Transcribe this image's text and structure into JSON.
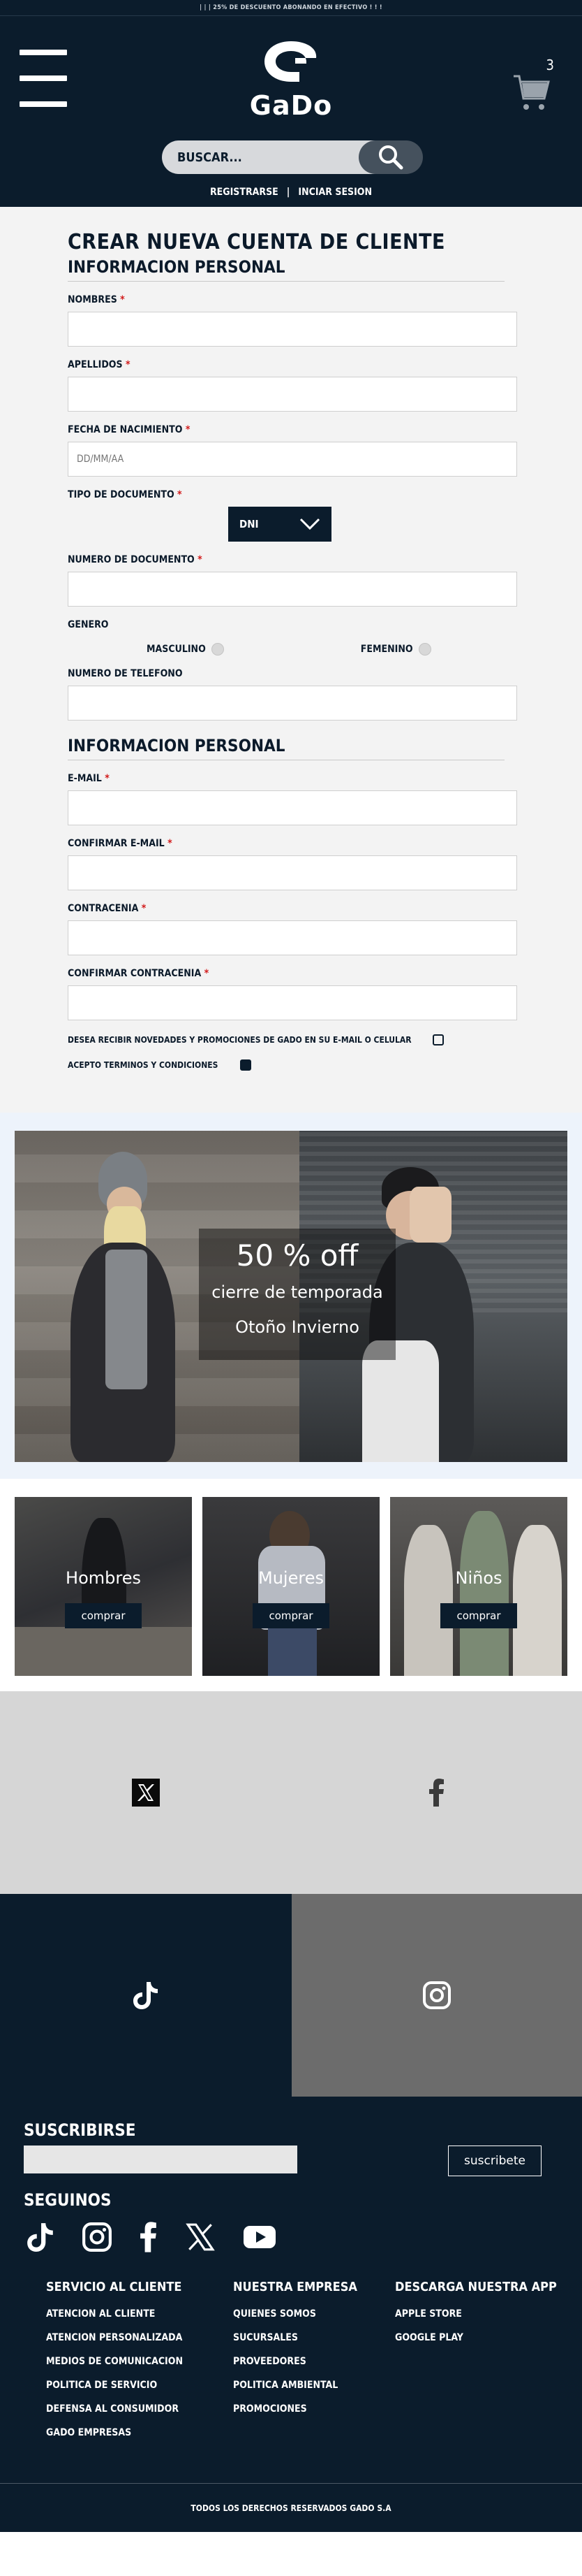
{
  "topbar": {
    "text": "| | | 25% DE DESCUENTO ABONANDO EN EFECTIVO ! ! !"
  },
  "header": {
    "brand": "GaDo",
    "cart_count": "3",
    "search_placeholder": "BUSCAR...",
    "register": "REGISTRARSE",
    "separator": "|",
    "login": "INCIAR SESION"
  },
  "form": {
    "title": "CREAR NUEVA CUENTA DE CLIENTE",
    "section_personal": "INFORMACION PERSONAL",
    "nombres": "NOMBRES",
    "apellidos": "APELLIDOS",
    "fecha": "FECHA DE NACIMIENTO",
    "fecha_placeholder": "DD/MM/AA",
    "tipo_doc": "TIPO DE DOCUMENTO",
    "doc_selected": "DNI",
    "numero_doc": "NUMERO DE DOCUMENTO",
    "genero": "GENERO",
    "masculino": "MASCULINO",
    "femenino": "FEMENINO",
    "telefono": "NUMERO DE TELEFONO",
    "section_contact": "INFORMACION PERSONAL",
    "email": "E-MAIL",
    "confirm_email": "CONFIRMAR E-MAIL",
    "password": "CONTRACENIA",
    "confirm_password": "CONFIRMAR CONTRACENIA",
    "newsletter": "DESEA RECIBIR NOVEDADES Y PROMOCIONES DE GADO EN SU E-MAIL O CELULAR",
    "terms": "ACEPTO TERMINOS Y CONDICIONES",
    "required_mark": "*"
  },
  "promo": {
    "headline": "50 % off",
    "subtitle": "cierre de temporada",
    "season": "Otoño Invierno"
  },
  "categories": [
    {
      "title": "Hombres",
      "button": "comprar"
    },
    {
      "title": "Mujeres",
      "button": "comprar"
    },
    {
      "title": "Niños",
      "button": "comprar"
    }
  ],
  "footer": {
    "subscribe_title": "SUSCRIBIRSE",
    "subscribe_button": "suscribete",
    "follow_title": "SEGUINOS",
    "col1": {
      "title": "SERVICIO AL CLIENTE",
      "links": [
        "ATENCION AL CLIENTE",
        "ATENCION PERSONALIZADA",
        "MEDIOS DE COMUNICACION",
        "POLITICA DE SERVICIO",
        "DEFENSA AL CONSUMIDOR",
        "GADO EMPRESAS"
      ]
    },
    "col2": {
      "title": "NUESTRA EMPRESA",
      "links": [
        "QUIENES SOMOS",
        "SUCURSALES",
        "PROVEEDORES",
        "POLITICA AMBIENTAL",
        "PROMOCIONES"
      ]
    },
    "col3": {
      "title": "DESCARGA NUESTRA APP",
      "links": [
        "APPLE STORE",
        "GOOGLE PLAY"
      ]
    },
    "copyright": "TODOS LOS DERECHOS RESERVADOS GADO S.A"
  },
  "colors": {
    "navy": "#0b1c2c",
    "required": "#d21c1c",
    "form_bg": "#f3f3f3",
    "promo_bg": "#edf3fb"
  }
}
